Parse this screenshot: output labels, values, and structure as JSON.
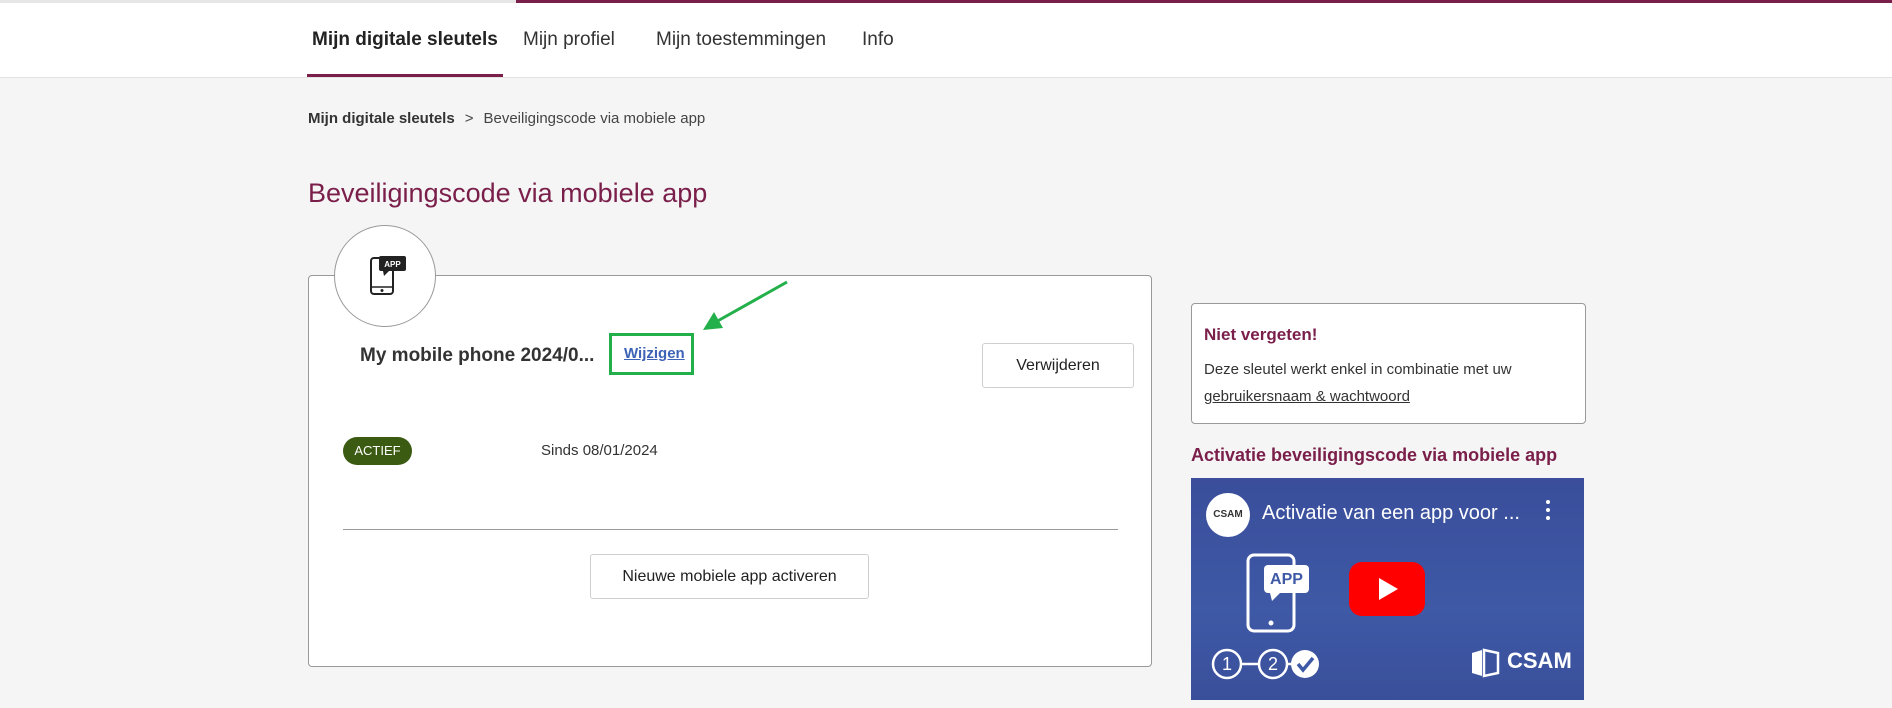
{
  "nav": {
    "tabs": [
      {
        "label": "Mijn digitale sleutels",
        "active": true
      },
      {
        "label": "Mijn profiel",
        "active": false
      },
      {
        "label": "Mijn toestemmingen",
        "active": false
      },
      {
        "label": "Info",
        "active": false
      }
    ]
  },
  "breadcrumb": {
    "items": [
      "Mijn digitale sleutels",
      "Beveiligingscode via mobiele app"
    ],
    "separator": ">"
  },
  "page": {
    "title": "Beveiligingscode via mobiele app"
  },
  "key_card": {
    "icon_label": "APP",
    "device_name": "My mobile phone 2024/0...",
    "edit_link": "Wijzigen",
    "remove_button": "Verwijderen",
    "status": "ACTIEF",
    "since": "Sinds 08/01/2024",
    "new_button": "Nieuwe mobiele app activeren"
  },
  "reminder": {
    "title": "Niet vergeten!",
    "text": "Deze sleutel werkt enkel in combinatie met uw",
    "link": "gebruikersnaam & wachtwoord"
  },
  "video": {
    "heading": "Activatie beveiligingscode via mobiele app",
    "channel_logo": "CSAM",
    "title": "Activatie van een app voor ...",
    "thumb_app_label": "APP",
    "steps": [
      "1",
      "2"
    ],
    "brand": "CSAM"
  },
  "colors": {
    "accent": "#7a1e4a",
    "status_active": "#3b5a12",
    "highlight": "#23b04a",
    "link": "#3d63b7",
    "video_bg": "#3e59a6",
    "play_red": "#ff0000"
  }
}
